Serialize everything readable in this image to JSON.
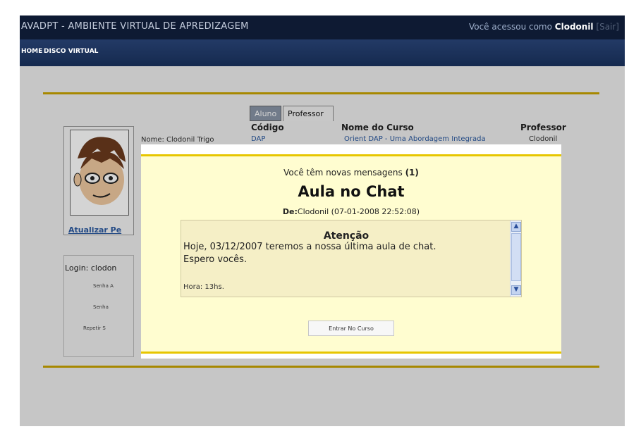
{
  "header": {
    "app_title": "AVADPT - AMBIENTE VIRTUAL DE APREDIZAGEM",
    "user_prefix": "Você acessou como ",
    "user_name": "Clodonil",
    "logout_label": "[Sair]"
  },
  "nav": {
    "items": [
      {
        "label": "HOME"
      },
      {
        "label": "DISCO VIRTUAL"
      }
    ]
  },
  "profile": {
    "name_text": "Nome: Clodonil Trigo",
    "update_link": "Atualizar Pe",
    "login_label": "Login: clodon",
    "password_labels": [
      "Senha A",
      "Senha",
      "Repetir S"
    ]
  },
  "courses": {
    "tabs": [
      {
        "label": "Aluno"
      },
      {
        "label": "Professor"
      }
    ],
    "columns": [
      "Código",
      "Nome do Curso",
      "Professor"
    ],
    "row": [
      "DAP",
      "Orient DAP - Uma Abordagem Integrada",
      "Clodonil"
    ]
  },
  "modal": {
    "new_messages_text": "Você têm novas mensagens",
    "new_messages_count": "(1)",
    "title": "Aula no Chat",
    "from_label": "De:",
    "from_value": "Clodonil (07-01-2008 22:52:08)",
    "body": {
      "heading": "Atenção",
      "line1": "Hoje, 03/12/2007 teremos a nossa última aula de chat.",
      "line2": "Espero vocês.",
      "hour": "Hora: 13hs."
    },
    "enter_button": "Entrar No Curso"
  },
  "icons": {
    "scroll_up": "scroll-up-arrow-icon",
    "scroll_down": "scroll-down-arrow-icon",
    "avatar": "cartoon-avatar"
  },
  "colors": {
    "header_bg": "#0e1a33",
    "nav_bg": "#1d3560",
    "modal_bg": "#fffdd0",
    "accent_gold": "#e7c600"
  }
}
